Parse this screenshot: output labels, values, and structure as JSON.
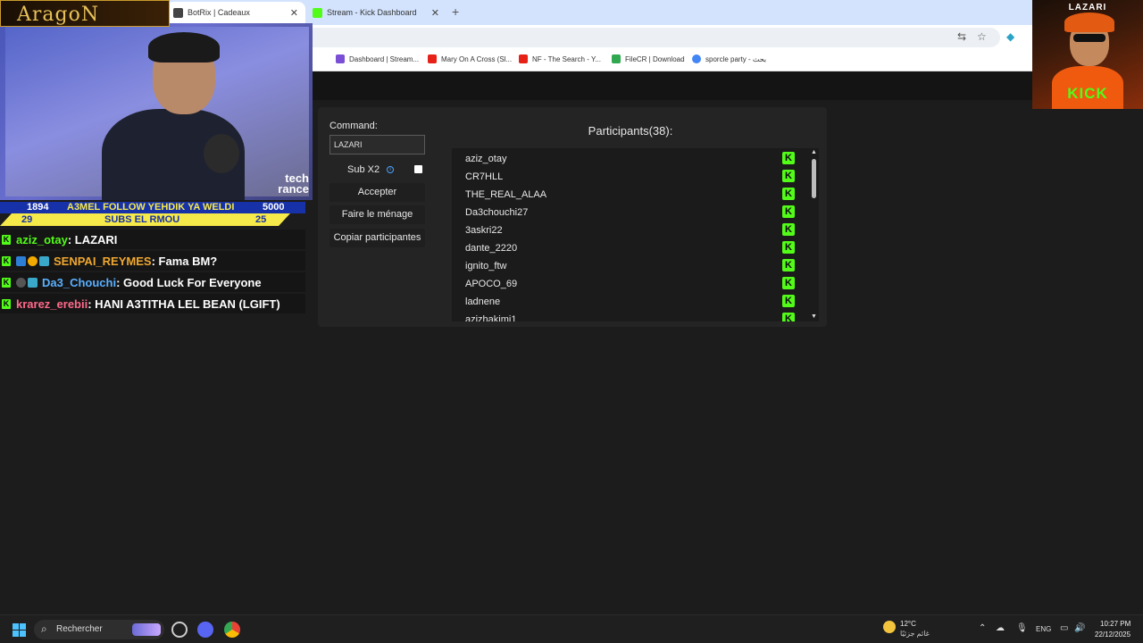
{
  "browser": {
    "tabs": [
      {
        "title": "BotRix | Cadeaux",
        "close": "✕",
        "favicon_color": "#444444"
      },
      {
        "title": "Stream - Kick Dashboard",
        "close": "✕",
        "favicon_color": "#53fc18"
      }
    ],
    "new_tab": "+",
    "toolbar_icons": [
      "translate-icon",
      "star-icon",
      "extension-icon"
    ],
    "bookmarks": [
      {
        "label": "Dashboard | Stream...",
        "icon": "sl-icon",
        "color": "#7a4fd6"
      },
      {
        "label": "Mary On A Cross (Sl...",
        "icon": "youtube-icon",
        "color": "#e62117"
      },
      {
        "label": "NF - The Search - Y...",
        "icon": "youtube-icon",
        "color": "#e62117"
      },
      {
        "label": "FileCR | Download",
        "icon": "filecr-icon",
        "color": "#2fa84f"
      },
      {
        "label": "sporcle party - بحث",
        "icon": "google-icon",
        "color": "#4285f4"
      }
    ]
  },
  "gift_panel": {
    "command_label": "Command:",
    "command_value": "LAZARI",
    "sub_label": "Sub X2",
    "sub_checked": false,
    "buttons": [
      "Accepter",
      "Faire le ménage",
      "Copiar participantes"
    ],
    "participants_title": "Participants(38):",
    "participants": [
      "aziz_otay",
      "CR7HLL",
      "THE_REAL_ALAA",
      "Da3chouchi27",
      "3askri22",
      "dante_2220",
      "ignito_ftw",
      "APOCO_69",
      "ladnene",
      "azizhakimi1"
    ],
    "platform_icon": "kick-icon",
    "kick_color": "#53fc18"
  },
  "overlay": {
    "brand": "AragoN",
    "cam_text": "tech rance",
    "goal1": {
      "left": "1894",
      "text": "A3MEL FOLLOW YEHDIK YA WELDI",
      "right": "5000"
    },
    "goal2": {
      "left": "29",
      "text": "SUBS EL RMOU",
      "right": "25"
    },
    "chat": [
      {
        "user": "aziz_otay",
        "message": ": LAZARI",
        "color": "#53fc18"
      },
      {
        "user": "SENPAI_REYMES",
        "message": ": Fama BM?",
        "color": "#f0a830"
      },
      {
        "user": "Da3_Chouchi",
        "message": ": Good Luck For Everyone",
        "color": "#5ab0ff"
      },
      {
        "user": "krarez_erebii",
        "message": ": HANI A3TITHA LEL BEAN (LGIFT)",
        "color": "#ff6a8a"
      }
    ]
  },
  "streamer_card": {
    "title": "LAZARI",
    "kick": "KICK"
  },
  "taskbar": {
    "search_placeholder": "Rechercher",
    "weather_temp": "12°C",
    "weather_cond": "غائم جزئيًا",
    "language": "ENG",
    "time": "10:27 PM",
    "date": "22/12/2025"
  }
}
